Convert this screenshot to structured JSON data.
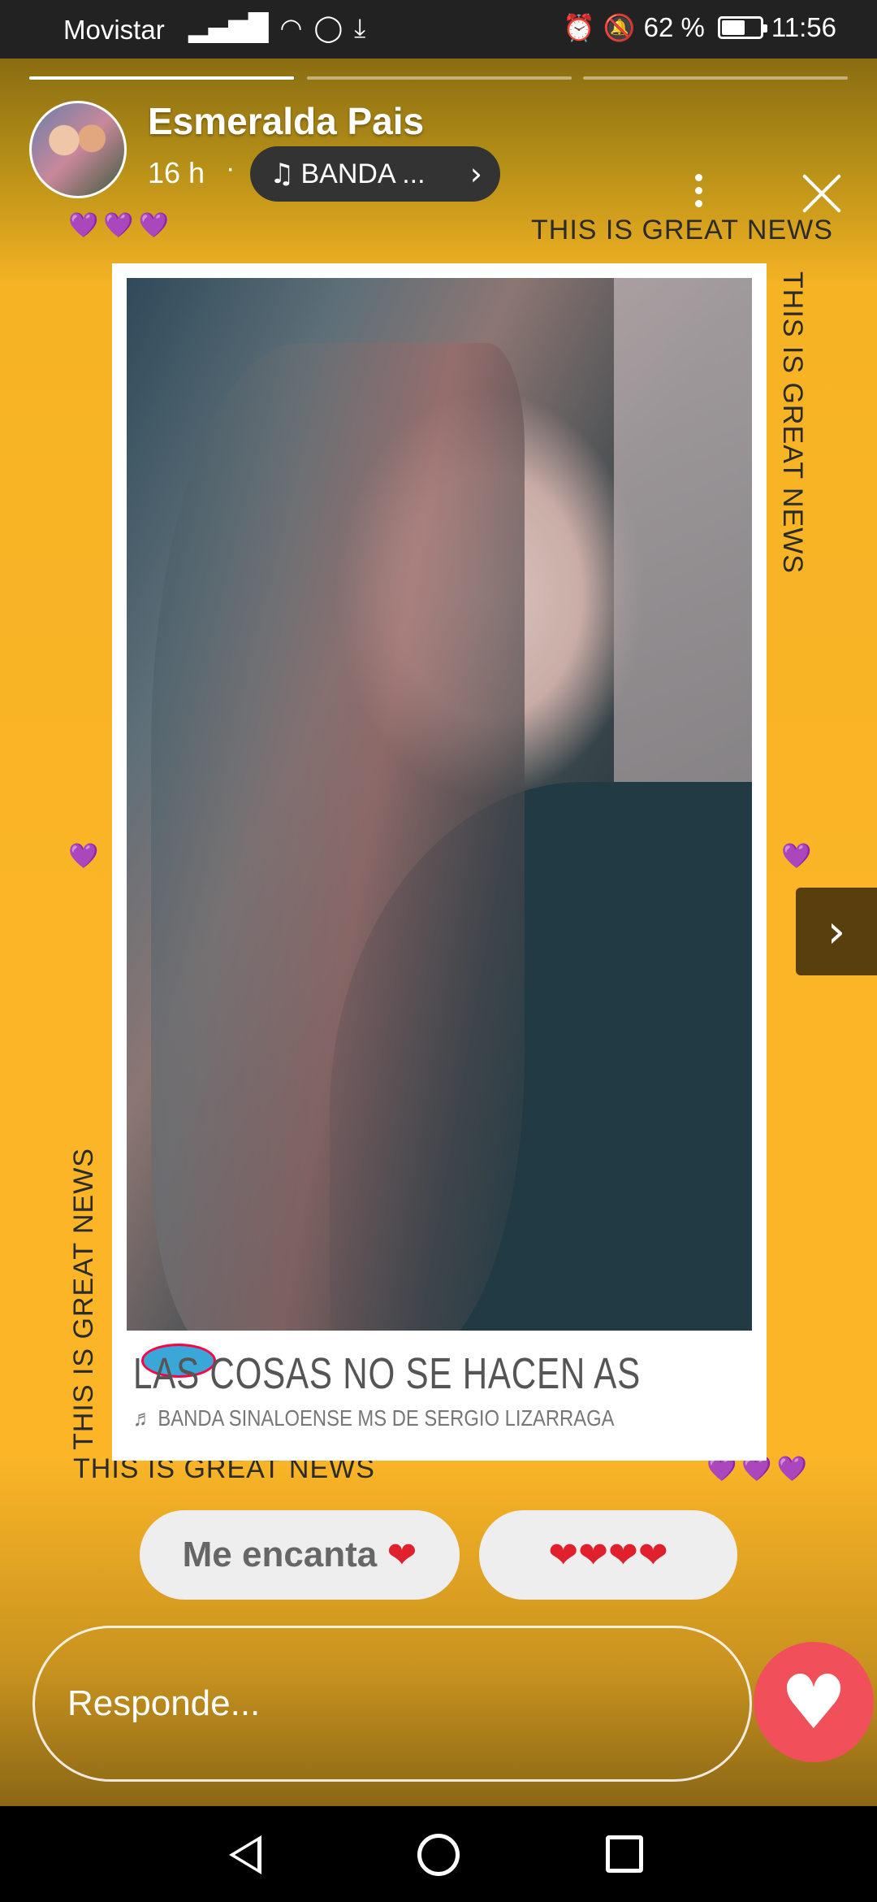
{
  "status_bar": {
    "carrier": "Movistar",
    "battery_percent": "62 %",
    "battery_level": 0.62,
    "time": "11:56"
  },
  "story": {
    "progress": [
      1.0,
      0.0,
      0.0
    ],
    "user_name": "Esmeralda Pais",
    "time_ago": "16 h",
    "separator": "·",
    "music_label": "BANDA ...",
    "sticker_text": "THIS IS GREAT NEWS",
    "hearts": "💜💜💜",
    "single_heart": "💜",
    "song": {
      "title": "LAS COSAS NO SE HACEN AS",
      "artist": "♬ BANDA SINALOENSE MS DE SERGIO LIZARRAGA"
    }
  },
  "quick_reactions": [
    {
      "label": "Me encanta",
      "emoji": "❤"
    },
    {
      "label": "",
      "emoji": "❤❤❤❤"
    }
  ],
  "reply": {
    "placeholder": "Responde..."
  },
  "icons": {
    "music": "music-note-icon",
    "more": "more-vertical-icon",
    "close": "close-icon",
    "next": "chevron-right-icon",
    "like": "heart-icon"
  }
}
